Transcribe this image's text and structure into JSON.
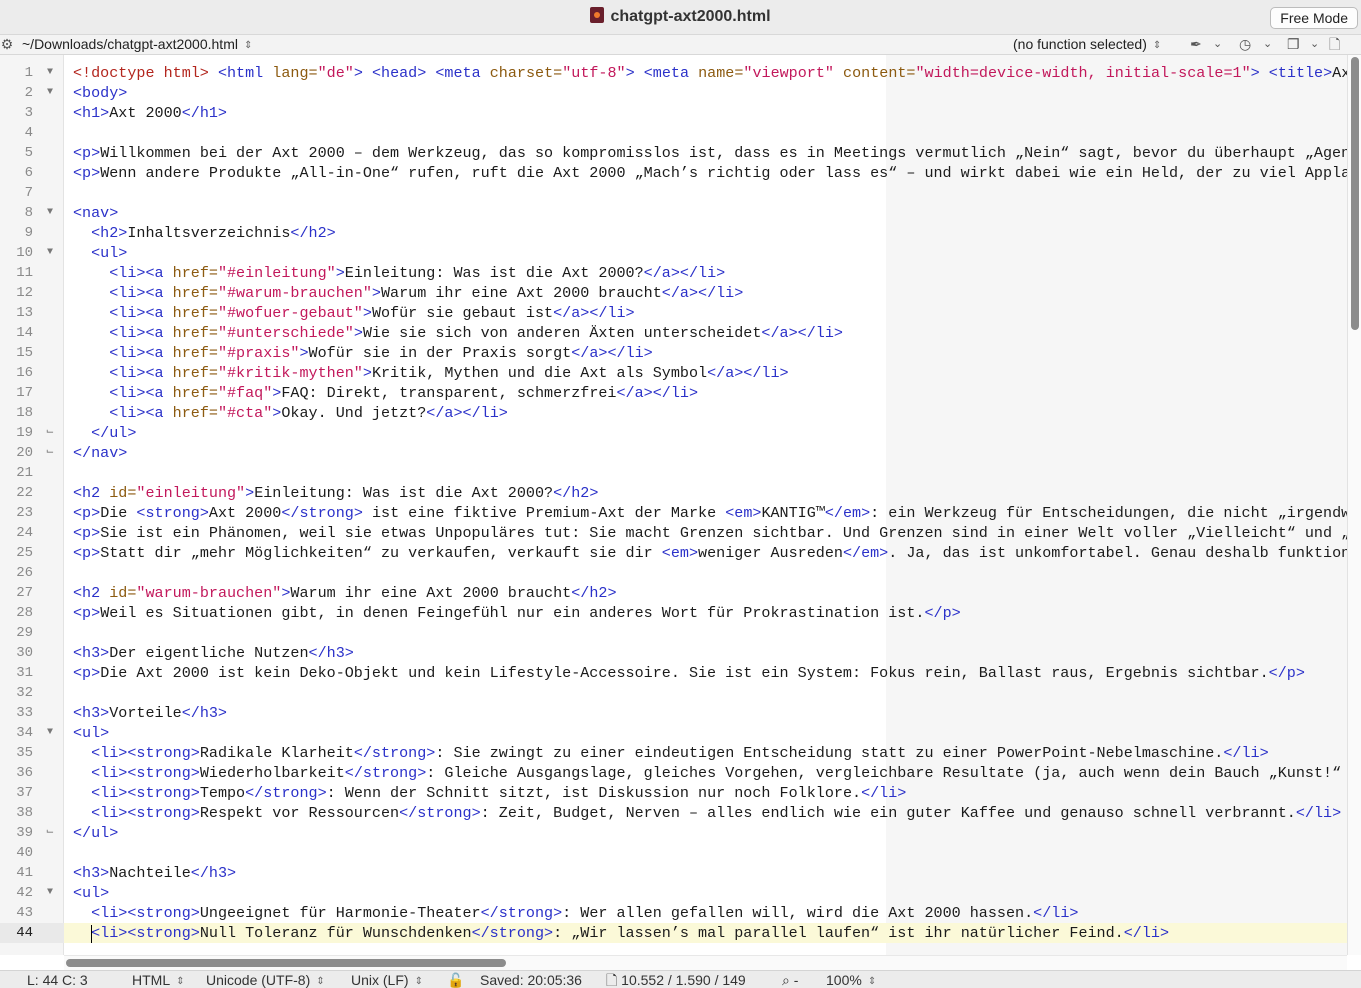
{
  "window": {
    "title": "chatgpt-axt2000.html",
    "mode_button": "Free Mode"
  },
  "navbar": {
    "path": "~/Downloads/chatgpt-axt2000.html",
    "function_menu": "(no function selected)"
  },
  "icons": {
    "file": "html-file-icon",
    "gear": "gear-icon",
    "marker": "pen-marker-icon",
    "history": "clock-history-icon",
    "docs": "stacked-documents-icon",
    "file_info": "document-icon",
    "lock": "lock-icon",
    "zoom": "magnifier-icon"
  },
  "editor": {
    "current_line": 44,
    "line_numbers": [
      "1",
      "2",
      "3",
      "4",
      "5",
      "6",
      "7",
      "8",
      "9",
      "10",
      "11",
      "12",
      "13",
      "14",
      "15",
      "16",
      "17",
      "18",
      "19",
      "20",
      "21",
      "22",
      "23",
      "24",
      "25",
      "26",
      "27",
      "28",
      "29",
      "30",
      "31",
      "32",
      "33",
      "34",
      "35",
      "36",
      "37",
      "38",
      "39",
      "40",
      "41",
      "42",
      "43",
      "44"
    ],
    "fold_markers": {
      "1": "open",
      "2": "open",
      "8": "open",
      "10": "open",
      "19": "close",
      "20": "close",
      "34": "open",
      "39": "close",
      "42": "open"
    },
    "lines": [
      [
        [
          "d",
          "<!doctype html>"
        ],
        [
          "p",
          " "
        ],
        [
          "t",
          "<html "
        ],
        [
          "a",
          "lang="
        ],
        [
          "v",
          "\"de\""
        ],
        [
          "t",
          ">"
        ],
        [
          "p",
          " "
        ],
        [
          "t",
          "<head>"
        ],
        [
          "p",
          " "
        ],
        [
          "t",
          "<meta "
        ],
        [
          "a",
          "charset="
        ],
        [
          "v",
          "\"utf-8\""
        ],
        [
          "t",
          ">"
        ],
        [
          "p",
          " "
        ],
        [
          "t",
          "<meta "
        ],
        [
          "a",
          "name="
        ],
        [
          "v",
          "\"viewport\""
        ],
        [
          "p",
          " "
        ],
        [
          "a",
          "content="
        ],
        [
          "v",
          "\"width=device-width, initial-scale=1\""
        ],
        [
          "t",
          ">"
        ],
        [
          "p",
          " "
        ],
        [
          "t",
          "<title>"
        ],
        [
          "p",
          "Ax"
        ]
      ],
      [
        [
          "t",
          "<body>"
        ]
      ],
      [
        [
          "t",
          "<h1>"
        ],
        [
          "p",
          "Axt 2000"
        ],
        [
          "t",
          "</h1>"
        ]
      ],
      [],
      [
        [
          "t",
          "<p>"
        ],
        [
          "p",
          "Willkommen bei der Axt 2000 – dem Werkzeug, das so kompromisslos ist, dass es in Meetings vermutlich „Nein“ sagt, bevor du überhaupt „Agen"
        ]
      ],
      [
        [
          "t",
          "<p>"
        ],
        [
          "p",
          "Wenn andere Produkte „All-in-One“ rufen, ruft die Axt 2000 „Mach’s richtig oder lass es“ – und wirkt dabei wie ein Held, der zu viel Appla"
        ]
      ],
      [],
      [
        [
          "t",
          "<nav>"
        ]
      ],
      [
        [
          "p",
          "  "
        ],
        [
          "t",
          "<h2>"
        ],
        [
          "p",
          "Inhaltsverzeichnis"
        ],
        [
          "t",
          "</h2>"
        ]
      ],
      [
        [
          "p",
          "  "
        ],
        [
          "t",
          "<ul>"
        ]
      ],
      [
        [
          "p",
          "    "
        ],
        [
          "t",
          "<li><a "
        ],
        [
          "a",
          "href="
        ],
        [
          "v",
          "\"#einleitung\""
        ],
        [
          "t",
          ">"
        ],
        [
          "p",
          "Einleitung: Was ist die Axt 2000?"
        ],
        [
          "t",
          "</a></li>"
        ]
      ],
      [
        [
          "p",
          "    "
        ],
        [
          "t",
          "<li><a "
        ],
        [
          "a",
          "href="
        ],
        [
          "v",
          "\"#warum-brauchen\""
        ],
        [
          "t",
          ">"
        ],
        [
          "p",
          "Warum ihr eine Axt 2000 braucht"
        ],
        [
          "t",
          "</a></li>"
        ]
      ],
      [
        [
          "p",
          "    "
        ],
        [
          "t",
          "<li><a "
        ],
        [
          "a",
          "href="
        ],
        [
          "v",
          "\"#wofuer-gebaut\""
        ],
        [
          "t",
          ">"
        ],
        [
          "p",
          "Wofür sie gebaut ist"
        ],
        [
          "t",
          "</a></li>"
        ]
      ],
      [
        [
          "p",
          "    "
        ],
        [
          "t",
          "<li><a "
        ],
        [
          "a",
          "href="
        ],
        [
          "v",
          "\"#unterschiede\""
        ],
        [
          "t",
          ">"
        ],
        [
          "p",
          "Wie sie sich von anderen Äxten unterscheidet"
        ],
        [
          "t",
          "</a></li>"
        ]
      ],
      [
        [
          "p",
          "    "
        ],
        [
          "t",
          "<li><a "
        ],
        [
          "a",
          "href="
        ],
        [
          "v",
          "\"#praxis\""
        ],
        [
          "t",
          ">"
        ],
        [
          "p",
          "Wofür sie in der Praxis sorgt"
        ],
        [
          "t",
          "</a></li>"
        ]
      ],
      [
        [
          "p",
          "    "
        ],
        [
          "t",
          "<li><a "
        ],
        [
          "a",
          "href="
        ],
        [
          "v",
          "\"#kritik-mythen\""
        ],
        [
          "t",
          ">"
        ],
        [
          "p",
          "Kritik, Mythen und die Axt als Symbol"
        ],
        [
          "t",
          "</a></li>"
        ]
      ],
      [
        [
          "p",
          "    "
        ],
        [
          "t",
          "<li><a "
        ],
        [
          "a",
          "href="
        ],
        [
          "v",
          "\"#faq\""
        ],
        [
          "t",
          ">"
        ],
        [
          "p",
          "FAQ: Direkt, transparent, schmerzfrei"
        ],
        [
          "t",
          "</a></li>"
        ]
      ],
      [
        [
          "p",
          "    "
        ],
        [
          "t",
          "<li><a "
        ],
        [
          "a",
          "href="
        ],
        [
          "v",
          "\"#cta\""
        ],
        [
          "t",
          ">"
        ],
        [
          "p",
          "Okay. Und jetzt?"
        ],
        [
          "t",
          "</a></li>"
        ]
      ],
      [
        [
          "p",
          "  "
        ],
        [
          "t",
          "</ul>"
        ]
      ],
      [
        [
          "t",
          "</nav>"
        ]
      ],
      [],
      [
        [
          "t",
          "<h2 "
        ],
        [
          "a",
          "id="
        ],
        [
          "v",
          "\"einleitung\""
        ],
        [
          "t",
          ">"
        ],
        [
          "p",
          "Einleitung: Was ist die Axt 2000?"
        ],
        [
          "t",
          "</h2>"
        ]
      ],
      [
        [
          "t",
          "<p>"
        ],
        [
          "p",
          "Die "
        ],
        [
          "t",
          "<strong>"
        ],
        [
          "p",
          "Axt 2000"
        ],
        [
          "t",
          "</strong>"
        ],
        [
          "p",
          " ist eine fiktive Premium-Axt der Marke "
        ],
        [
          "t",
          "<em>"
        ],
        [
          "p",
          "KANTIG™"
        ],
        [
          "t",
          "</em>"
        ],
        [
          "p",
          ": ein Werkzeug für Entscheidungen, die nicht „irgendw"
        ]
      ],
      [
        [
          "t",
          "<p>"
        ],
        [
          "p",
          "Sie ist ein Phänomen, weil sie etwas Unpopuläres tut: Sie macht Grenzen sichtbar. Und Grenzen sind in einer Welt voller „Vielleicht“ und „"
        ]
      ],
      [
        [
          "t",
          "<p>"
        ],
        [
          "p",
          "Statt dir „mehr Möglichkeiten“ zu verkaufen, verkauft sie dir "
        ],
        [
          "t",
          "<em>"
        ],
        [
          "p",
          "weniger Ausreden"
        ],
        [
          "t",
          "</em>"
        ],
        [
          "p",
          ". Ja, das ist unkomfortabel. Genau deshalb funktion"
        ]
      ],
      [],
      [
        [
          "t",
          "<h2 "
        ],
        [
          "a",
          "id="
        ],
        [
          "v",
          "\"warum-brauchen\""
        ],
        [
          "t",
          ">"
        ],
        [
          "p",
          "Warum ihr eine Axt 2000 braucht"
        ],
        [
          "t",
          "</h2>"
        ]
      ],
      [
        [
          "t",
          "<p>"
        ],
        [
          "p",
          "Weil es Situationen gibt, in denen Feingefühl nur ein anderes Wort für Prokrastination ist."
        ],
        [
          "t",
          "</p>"
        ]
      ],
      [],
      [
        [
          "t",
          "<h3>"
        ],
        [
          "p",
          "Der eigentliche Nutzen"
        ],
        [
          "t",
          "</h3>"
        ]
      ],
      [
        [
          "t",
          "<p>"
        ],
        [
          "p",
          "Die Axt 2000 ist kein Deko-Objekt und kein Lifestyle-Accessoire. Sie ist ein System: Fokus rein, Ballast raus, Ergebnis sichtbar."
        ],
        [
          "t",
          "</p>"
        ]
      ],
      [],
      [
        [
          "t",
          "<h3>"
        ],
        [
          "p",
          "Vorteile"
        ],
        [
          "t",
          "</h3>"
        ]
      ],
      [
        [
          "t",
          "<ul>"
        ]
      ],
      [
        [
          "p",
          "  "
        ],
        [
          "t",
          "<li><strong>"
        ],
        [
          "p",
          "Radikale Klarheit"
        ],
        [
          "t",
          "</strong>"
        ],
        [
          "p",
          ": Sie zwingt zu einer eindeutigen Entscheidung statt zu einer PowerPoint-Nebelmaschine."
        ],
        [
          "t",
          "</li>"
        ]
      ],
      [
        [
          "p",
          "  "
        ],
        [
          "t",
          "<li><strong>"
        ],
        [
          "p",
          "Wiederholbarkeit"
        ],
        [
          "t",
          "</strong>"
        ],
        [
          "p",
          ": Gleiche Ausgangslage, gleiches Vorgehen, vergleichbare Resultate (ja, auch wenn dein Bauch „Kunst!“"
        ]
      ],
      [
        [
          "p",
          "  "
        ],
        [
          "t",
          "<li><strong>"
        ],
        [
          "p",
          "Tempo"
        ],
        [
          "t",
          "</strong>"
        ],
        [
          "p",
          ": Wenn der Schnitt sitzt, ist Diskussion nur noch Folklore."
        ],
        [
          "t",
          "</li>"
        ]
      ],
      [
        [
          "p",
          "  "
        ],
        [
          "t",
          "<li><strong>"
        ],
        [
          "p",
          "Respekt vor Ressourcen"
        ],
        [
          "t",
          "</strong>"
        ],
        [
          "p",
          ": Zeit, Budget, Nerven – alles endlich wie ein guter Kaffee und genauso schnell verbrannt."
        ],
        [
          "t",
          "</li>"
        ]
      ],
      [
        [
          "t",
          "</ul>"
        ]
      ],
      [],
      [
        [
          "t",
          "<h3>"
        ],
        [
          "p",
          "Nachteile"
        ],
        [
          "t",
          "</h3>"
        ]
      ],
      [
        [
          "t",
          "<ul>"
        ]
      ],
      [
        [
          "p",
          "  "
        ],
        [
          "t",
          "<li><strong>"
        ],
        [
          "p",
          "Ungeeignet für Harmonie-Theater"
        ],
        [
          "t",
          "</strong>"
        ],
        [
          "p",
          ": Wer allen gefallen will, wird die Axt 2000 hassen."
        ],
        [
          "t",
          "</li>"
        ]
      ],
      [
        [
          "p",
          "  "
        ],
        [
          "t",
          "<li><strong>"
        ],
        [
          "p",
          "Null Toleranz für Wunschdenken"
        ],
        [
          "t",
          "</strong>"
        ],
        [
          "p",
          ": „Wir lassen’s mal parallel laufen“ ist ihr natürlicher Feind."
        ],
        [
          "t",
          "</li>"
        ]
      ]
    ]
  },
  "status": {
    "position": "L: 44 C: 3",
    "language": "HTML",
    "encoding": "Unicode (UTF-8)",
    "line_endings": "Unix (LF)",
    "saved": "Saved: 20:05:36",
    "stats": "10.552 / 1.590 / 149",
    "zoom_minus": "-",
    "zoom": "100%"
  }
}
